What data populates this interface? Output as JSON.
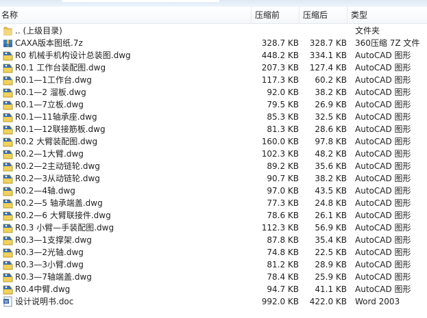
{
  "columns": {
    "name": "名称",
    "size": "压缩前",
    "compressed": "压缩后",
    "type": "类型"
  },
  "rows": [
    {
      "icon": "folder-up",
      "name": ".. (上级目录)",
      "size": "",
      "compressed": "",
      "type": "文件夹"
    },
    {
      "icon": "archive",
      "name": "CAXA版本图纸.7z",
      "size": "328.7 KB",
      "compressed": "328.7 KB",
      "type": "360压缩 7Z 文件"
    },
    {
      "icon": "dwg",
      "name": "R0 机械手机构设计总装图.dwg",
      "size": "448.2 KB",
      "compressed": "334.1 KB",
      "type": "AutoCAD 图形"
    },
    {
      "icon": "dwg",
      "name": "R0.1 工作台装配图.dwg",
      "size": "207.3 KB",
      "compressed": "127.4 KB",
      "type": "AutoCAD 图形"
    },
    {
      "icon": "dwg",
      "name": "R0.1—1工作台.dwg",
      "size": "117.3 KB",
      "compressed": "60.2 KB",
      "type": "AutoCAD 图形"
    },
    {
      "icon": "dwg",
      "name": "R0.1—2 溜板.dwg",
      "size": "92.0 KB",
      "compressed": "38.2 KB",
      "type": "AutoCAD 图形"
    },
    {
      "icon": "dwg",
      "name": "R0.1—7立板.dwg",
      "size": "79.5 KB",
      "compressed": "26.9 KB",
      "type": "AutoCAD 图形"
    },
    {
      "icon": "dwg",
      "name": "R0.1—11轴承座.dwg",
      "size": "85.3 KB",
      "compressed": "32.5 KB",
      "type": "AutoCAD 图形"
    },
    {
      "icon": "dwg",
      "name": "R0.1—12联接筋板.dwg",
      "size": "81.3 KB",
      "compressed": "28.6 KB",
      "type": "AutoCAD 图形"
    },
    {
      "icon": "dwg",
      "name": "R0.2 大臂装配图.dwg",
      "size": "160.0 KB",
      "compressed": "97.8 KB",
      "type": "AutoCAD 图形"
    },
    {
      "icon": "dwg",
      "name": "R0.2—1大臂.dwg",
      "size": "102.3 KB",
      "compressed": "48.2 KB",
      "type": "AutoCAD 图形"
    },
    {
      "icon": "dwg",
      "name": "R0.2—2主动链轮.dwg",
      "size": "89.2 KB",
      "compressed": "35.6 KB",
      "type": "AutoCAD 图形"
    },
    {
      "icon": "dwg",
      "name": "R0.2—3从动链轮.dwg",
      "size": "90.7 KB",
      "compressed": "38.2 KB",
      "type": "AutoCAD 图形"
    },
    {
      "icon": "dwg",
      "name": "R0.2—4轴.dwg",
      "size": "97.0 KB",
      "compressed": "43.5 KB",
      "type": "AutoCAD 图形"
    },
    {
      "icon": "dwg",
      "name": "R0.2—5 轴承端盖.dwg",
      "size": "77.3 KB",
      "compressed": "24.8 KB",
      "type": "AutoCAD 图形"
    },
    {
      "icon": "dwg",
      "name": "R0.2—6 大臂联接件.dwg",
      "size": "78.6 KB",
      "compressed": "26.1 KB",
      "type": "AutoCAD 图形"
    },
    {
      "icon": "dwg",
      "name": "R0.3 小臂—手装配图.dwg",
      "size": "112.3 KB",
      "compressed": "56.9 KB",
      "type": "AutoCAD 图形"
    },
    {
      "icon": "dwg",
      "name": "R0.3—1支撑架.dwg",
      "size": "87.8 KB",
      "compressed": "35.4 KB",
      "type": "AutoCAD 图形"
    },
    {
      "icon": "dwg",
      "name": "R0.3—2光轴.dwg",
      "size": "74.8 KB",
      "compressed": "22.5 KB",
      "type": "AutoCAD 图形"
    },
    {
      "icon": "dwg",
      "name": "R0.3—3小臂.dwg",
      "size": "81.2 KB",
      "compressed": "28.9 KB",
      "type": "AutoCAD 图形"
    },
    {
      "icon": "dwg",
      "name": "R0.3—7轴端盖.dwg",
      "size": "78.4 KB",
      "compressed": "25.9 KB",
      "type": "AutoCAD 图形"
    },
    {
      "icon": "dwg",
      "name": "R0.4中臂.dwg",
      "size": "94.7 KB",
      "compressed": "41.1 KB",
      "type": "AutoCAD 图形"
    },
    {
      "icon": "word",
      "name": "设计说明书.doc",
      "size": "992.0 KB",
      "compressed": "422.0 KB",
      "type": "Word 2003"
    }
  ]
}
